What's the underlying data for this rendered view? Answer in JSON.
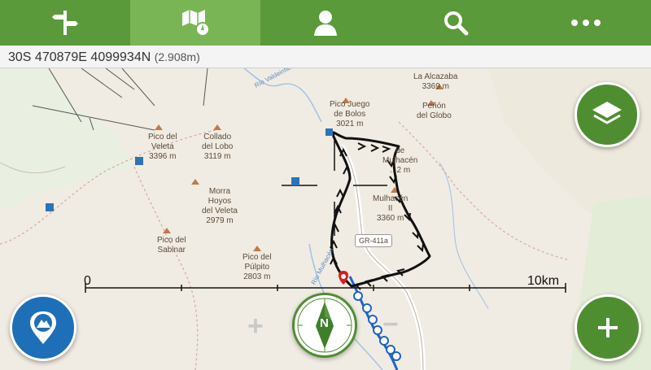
{
  "toolbar": {
    "tabs": [
      {
        "name": "waypoints-tab",
        "icon": "signpost-icon",
        "active": false
      },
      {
        "name": "map-tab",
        "icon": "map-compass-icon",
        "active": true
      },
      {
        "name": "profile-tab",
        "icon": "person-icon",
        "active": false
      },
      {
        "name": "search-tab",
        "icon": "search-icon",
        "active": false
      },
      {
        "name": "more-tab",
        "icon": "more-dots-icon",
        "active": false
      }
    ]
  },
  "coords": {
    "position": "30S 470879E 4099934N",
    "altitude": "(2.908m)"
  },
  "map": {
    "labels": {
      "alcazaba": "La Alcazaba",
      "alcazaba_ele": "3369 m",
      "penon": "Peñón",
      "penon2": "del Globo",
      "juego": "Pico Juego",
      "juego2": "de Bolos",
      "juego_ele": "3021 m",
      "veleta": "Pico del",
      "veleta2": "Veleta",
      "veleta_ele": "3396 m",
      "collado": "Collado",
      "collado2": "del Lobo",
      "collado_ele": "3119 m",
      "morra": "Morra",
      "morra2": "Hoyos",
      "morra3": "del Veleta",
      "morra_ele": "2979 m",
      "mulhacen_top": "de",
      "mulhacen_top2": "Mulhacén",
      "mulhacen_ele1": "...2 m",
      "mulhacen": "Mulhacén",
      "mulhacen2": "II",
      "mulhacen_ele": "3360 m",
      "sabinar": "Pico del",
      "sabinar2": "Sabinar",
      "pulpito": "Pico del",
      "pulpito2": "Púlpito",
      "pulpito_ele": "2803 m",
      "road": "GR-411a",
      "river": "Río Valdeinfierno",
      "river2": "Río Mulhacén"
    },
    "scale": {
      "start": "0",
      "end": "10km"
    },
    "zoom_in": "+",
    "zoom_out": "−",
    "compass": "N"
  },
  "colors": {
    "toolbar": "#5a9a3a",
    "toolbar_active": "#79b455",
    "fab_green": "#4e8e31",
    "fab_blue": "#1d6fb8",
    "track": "#111111",
    "route": "#1f63c8",
    "marker": "#d81e1e"
  }
}
